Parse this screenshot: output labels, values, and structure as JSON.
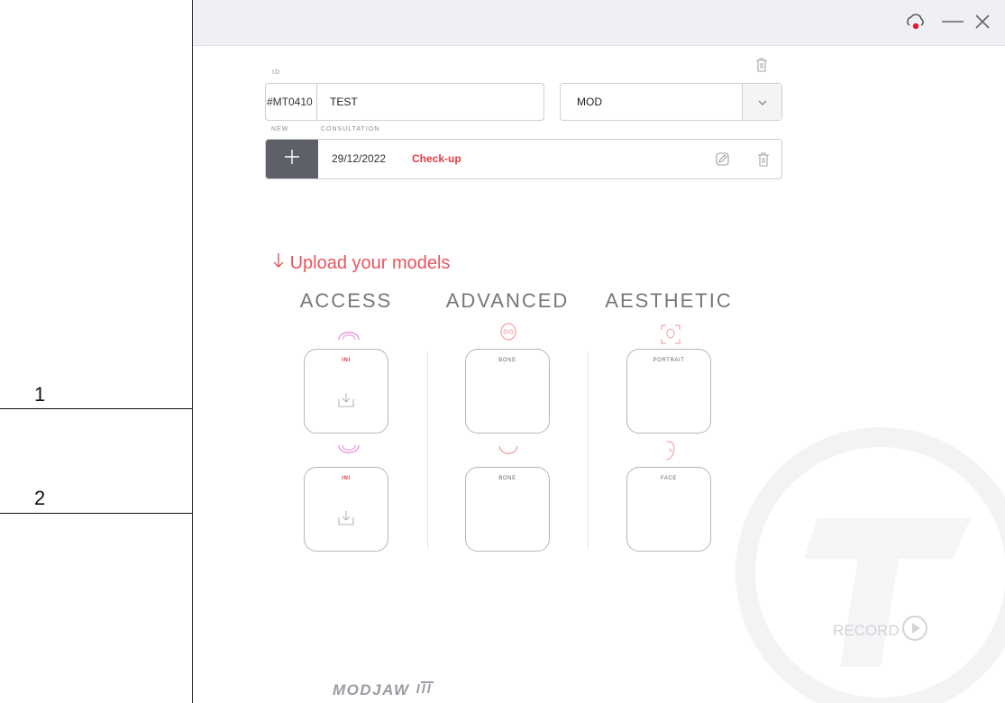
{
  "callouts": [
    "1",
    "2"
  ],
  "titlebar": {
    "cloud_icon": "cloud-record-icon",
    "minimize_icon": "minimize-icon",
    "close_icon": "close-icon",
    "accent_color": "#e01b2c"
  },
  "patient": {
    "id_label": "ID",
    "id_prefix": "#MT0410",
    "name_value": "TEST",
    "type_value": "MOD",
    "trash_icon": "trash-icon"
  },
  "consultation": {
    "new_label": "NEW",
    "consultation_label": "CONSULTATION",
    "date": "29/12/2022",
    "type": "Check-up",
    "edit_icon": "edit-icon",
    "trash_icon": "trash-icon"
  },
  "upload": {
    "title": "Upload your models",
    "arrow_icon": "arrow-down-icon",
    "columns": [
      {
        "heading": "ACCESS",
        "top_label": "INI",
        "bottom_label": "INI"
      },
      {
        "heading": "ADVANCED",
        "top_label": "BONE",
        "bottom_label": "BONE"
      },
      {
        "heading": "AESTHETIC",
        "top_label": "PORTRAIT",
        "bottom_label": "FACE"
      }
    ]
  },
  "record": {
    "label": "RECORD"
  },
  "brand": {
    "logo": "MODJAW"
  },
  "colors": {
    "accent": "#e03a46",
    "dark_button": "#5e6068",
    "background_titlebar": "#eff0f3"
  }
}
